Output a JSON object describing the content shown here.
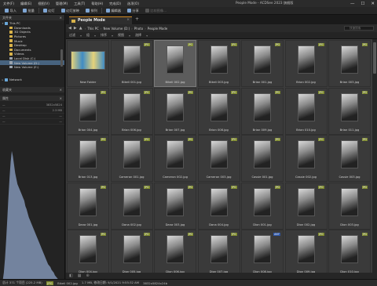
{
  "menubar": {
    "items": [
      "文件(F)",
      "编辑(E)",
      "视图(V)",
      "管理(M)",
      "工具(T)",
      "帮助(H)",
      "完成(D)",
      "选项(O)"
    ],
    "app_title": "People Mode - ACDSee 2023 旗舰版",
    "win_minimize": "—",
    "win_maximize": "☐",
    "win_close": "✕"
  },
  "toolbar": {
    "items": [
      {
        "label": "导入",
        "enabled": true
      },
      {
        "label": "批量",
        "enabled": true
      },
      {
        "label": "幻灯",
        "enabled": true
      },
      {
        "label": "幻灯放映",
        "enabled": true
      },
      {
        "label": "排列",
        "enabled": true
      },
      {
        "label": "编辑器",
        "enabled": true
      },
      {
        "label": "分享",
        "enabled": true
      },
      {
        "label": "比较图像...",
        "enabled": false
      }
    ]
  },
  "folder_panel": {
    "title": "文件夹",
    "tree": [
      {
        "label": "This PC",
        "level": 0,
        "icon": "computer-icon",
        "expanded": true
      },
      {
        "label": "Downloads",
        "level": 1,
        "icon": "folder-icon"
      },
      {
        "label": "3D Objects",
        "level": 1,
        "icon": "folder-icon"
      },
      {
        "label": "Pictures",
        "level": 1,
        "icon": "folder-icon"
      },
      {
        "label": "Music",
        "level": 1,
        "icon": "folder-icon"
      },
      {
        "label": "Desktop",
        "level": 1,
        "icon": "folder-icon"
      },
      {
        "label": "Documents",
        "level": 1,
        "icon": "folder-icon"
      },
      {
        "label": "Videos",
        "level": 1,
        "icon": "folder-icon"
      },
      {
        "label": "Local Disk (C:)",
        "level": 1,
        "icon": "drive-icon"
      },
      {
        "label": "New Volume (D:)",
        "level": 1,
        "icon": "drive-icon",
        "selected": true
      },
      {
        "label": "New Volume (E:)",
        "level": 1,
        "icon": "drive-icon"
      }
    ],
    "network_label": "Network",
    "favorites_label": "收藏夹"
  },
  "properties_panel": {
    "title": "属性",
    "rows": [
      {
        "k": "—",
        "v": "3832x5824"
      },
      {
        "k": "—",
        "v": "2.3 MB"
      },
      {
        "k": "—",
        "v": "—"
      },
      {
        "k": "—",
        "v": "—"
      }
    ]
  },
  "histogram": {
    "levels": [
      0.02,
      0.06,
      0.12,
      0.22,
      0.35,
      0.5,
      0.66,
      0.8,
      0.92,
      1.0,
      0.96,
      0.9,
      0.84,
      0.8,
      0.76,
      0.74,
      0.72,
      0.7,
      0.68,
      0.66,
      0.64,
      0.6,
      0.58,
      0.55,
      0.52,
      0.5,
      0.48,
      0.46,
      0.44,
      0.42,
      0.4,
      0.38,
      0.36,
      0.34,
      0.32,
      0.3,
      0.28,
      0.26,
      0.24,
      0.22,
      0.2,
      0.18,
      0.17,
      0.16,
      0.14,
      0.13,
      0.12,
      0.1,
      0.09,
      0.08,
      0.07,
      0.06,
      0.05,
      0.04,
      0.03
    ],
    "color": "#8fa4c8"
  },
  "tab": {
    "title": "People Mode",
    "close": "×",
    "add": "+"
  },
  "address": {
    "crumbs": [
      "This PC",
      "New Volume (D:)",
      "Photo",
      "People Mode"
    ],
    "search_placeholder": "快速搜索"
  },
  "filters": {
    "items": [
      "过滤",
      "组",
      "排序",
      "视图",
      "选择"
    ]
  },
  "grid": {
    "columns": 7,
    "items": [
      {
        "name": "New Folder",
        "badge": "",
        "selected": false
      },
      {
        "name": "Bikeli 001.jpg",
        "badge": "JPG",
        "selected": false
      },
      {
        "name": "Bikeli 002.jpg",
        "badge": "JPG",
        "selected": true
      },
      {
        "name": "Bikeli 003.jpg",
        "badge": "JPG",
        "selected": false
      },
      {
        "name": "Brian 001.jpg",
        "badge": "JPG",
        "selected": false
      },
      {
        "name": "Brian 002.jpg",
        "badge": "JPG",
        "selected": false
      },
      {
        "name": "Brian 003.jpg",
        "badge": "JPG",
        "selected": false
      },
      {
        "name": "Brian 004.jpg",
        "badge": "JPG",
        "selected": false
      },
      {
        "name": "Brian 006.jpg",
        "badge": "JPG",
        "selected": false
      },
      {
        "name": "Brian 007.jpg",
        "badge": "JPG",
        "selected": false
      },
      {
        "name": "Brian 008.jpg",
        "badge": "JPG",
        "selected": false
      },
      {
        "name": "Brian 009.jpg",
        "badge": "JPG",
        "selected": false
      },
      {
        "name": "Brian 010.jpg",
        "badge": "JPG",
        "selected": false
      },
      {
        "name": "Brian 011.jpg",
        "badge": "JPG",
        "selected": false
      },
      {
        "name": "Brian 013.jpg",
        "badge": "JPG",
        "selected": false
      },
      {
        "name": "Cameron 001.jpg",
        "badge": "JPG",
        "selected": false
      },
      {
        "name": "Cameron 002.jpg",
        "badge": "JPG",
        "selected": false
      },
      {
        "name": "Cameron 003.jpg",
        "badge": "JPG",
        "selected": false
      },
      {
        "name": "Cassie 001.jpg",
        "badge": "JPG",
        "selected": false
      },
      {
        "name": "Cassie 002.jpg",
        "badge": "JPG",
        "selected": false
      },
      {
        "name": "Cassie 003.jpg",
        "badge": "JPG",
        "selected": false
      },
      {
        "name": "Dana 001.jpg",
        "badge": "JPG",
        "selected": false
      },
      {
        "name": "Dana 002.jpg",
        "badge": "JPG",
        "selected": false
      },
      {
        "name": "Dana 003.jpg",
        "badge": "JPG",
        "selected": false
      },
      {
        "name": "Dana 004.jpg",
        "badge": "JPG",
        "selected": false
      },
      {
        "name": "Dion 001.jpg",
        "badge": "JPG",
        "selected": false
      },
      {
        "name": "Dion 002.jpg",
        "badge": "JPG",
        "selected": false
      },
      {
        "name": "Dion 003.jpg",
        "badge": "JPG",
        "selected": false
      },
      {
        "name": "Dion 004.jpg",
        "badge": "JPG",
        "selected": false
      },
      {
        "name": "Dion 005.jpg",
        "badge": "JPG",
        "selected": false
      },
      {
        "name": "Dion 006.jpg",
        "badge": "JPG",
        "selected": false
      },
      {
        "name": "Dion 007.jpg",
        "badge": "JPG",
        "selected": false
      },
      {
        "name": "Dion 008.jpg",
        "badge": "AVIF",
        "selected": false
      },
      {
        "name": "Dion 009.jpg",
        "badge": "JPG",
        "selected": false
      },
      {
        "name": "Dion 010.jpg",
        "badge": "JPG",
        "selected": false
      }
    ]
  },
  "status": {
    "total": "总计 371 个项目 (225.2 MB)",
    "badge": "JPG",
    "file": "Bikeli 002.jpg",
    "size": "1.7 MB, 修改日期: 9/1/2021 9:55:32 AM",
    "dims": "3832x5824x24b"
  }
}
